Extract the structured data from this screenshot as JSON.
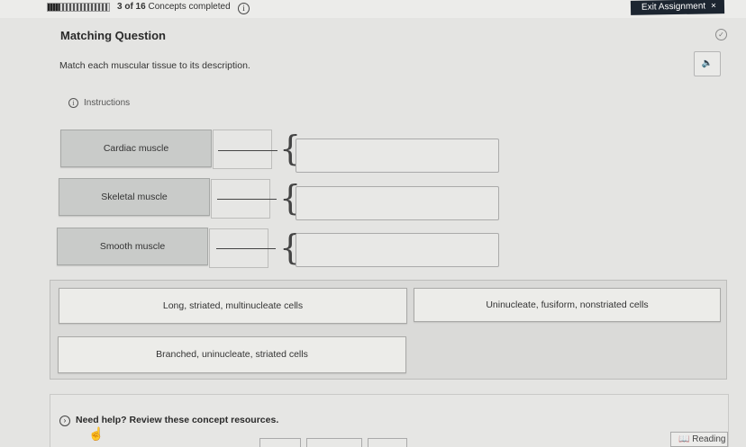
{
  "header": {
    "progress_count": "3 of 16",
    "progress_label": "Concepts completed",
    "progress_fraction": 0.1875,
    "exit_label": "Exit Assignment",
    "exit_icon": "×"
  },
  "question": {
    "title": "Matching Question",
    "prompt": "Match each muscular tissue to its description.",
    "instructions_label": "Instructions"
  },
  "terms": [
    {
      "label": "Cardiac muscle"
    },
    {
      "label": "Skeletal muscle"
    },
    {
      "label": "Smooth muscle"
    }
  ],
  "choices": [
    {
      "label": "Long, striated, multinucleate cells"
    },
    {
      "label": "Uninucleate, fusiform, nonstriated cells"
    },
    {
      "label": "Branched, uninucleate, striated cells"
    }
  ],
  "resources": {
    "help_label": "Need help? Review these concept resources.",
    "reading_label": "Reading"
  },
  "colors": {
    "exit_button_bg": "#1c2530",
    "term_bg": "#c9cbc9",
    "choice_bg": "#ecece9"
  }
}
